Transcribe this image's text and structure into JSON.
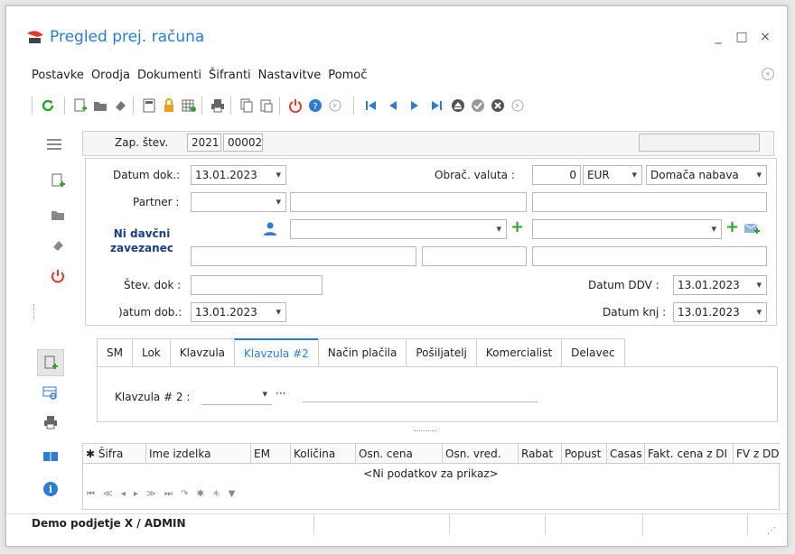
{
  "window": {
    "title": "Pregled prej. računa",
    "minimize": "_",
    "maximize": "□",
    "close": "×"
  },
  "menu": [
    "Postavke",
    "Orodja",
    "Dokumenti",
    "Šifranti",
    "Nastavitve",
    "Pomoč"
  ],
  "header": {
    "zap_label": "Zap. štev.",
    "year": "2021",
    "number": "00002"
  },
  "form": {
    "datum_dok_label": "Datum dok.:",
    "datum_dok": "13.01.2023",
    "obrac_valuta_label": "Obrač. valuta :",
    "obrac_valuta_value": "0",
    "currency": "EUR",
    "nabava": "Domača nabava",
    "partner_label": "Partner :",
    "ni_davcni": "Ni davčni zavezanec",
    "stev_dok_label": "Štev. dok :",
    "datum_ddv_label": "Datum DDV :",
    "datum_ddv": "13.01.2023",
    "datum_dob_label": ")atum dob.:",
    "datum_dob": "13.01.2023",
    "datum_knj_label": "Datum knj :",
    "datum_knj": "13.01.2023"
  },
  "tabs": [
    "SM",
    "Lok",
    "Klavzula",
    "Klavzula #2",
    "Način plačila",
    "Pošiljatelj",
    "Komercialist",
    "Delavec"
  ],
  "active_tab": "Klavzula #2",
  "tab_content": {
    "klavzula2_label": "Klavzula # 2 :",
    "dots": "···"
  },
  "grid": {
    "columns": [
      "Šifra",
      "Ime izdelka",
      "EM",
      "Količina",
      "Osn. cena",
      "Osn. vred.",
      "Rabat",
      "Popust",
      "Casas",
      "Fakt. cena z DI",
      "FV z DD"
    ],
    "empty_text": "<Ni podatkov za prikaz>"
  },
  "status": {
    "company": "Demo podjetje X / ADMIN"
  },
  "colors": {
    "accent": "#2a7dd1",
    "green": "#2aa52a",
    "red": "#e03a2a"
  }
}
